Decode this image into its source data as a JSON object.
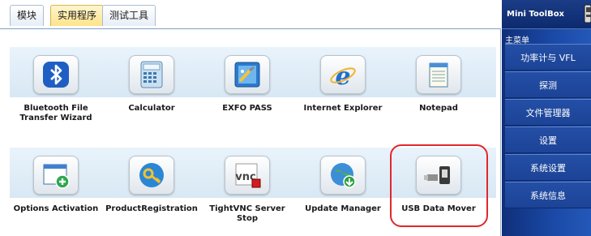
{
  "tabs": [
    {
      "label": "模块",
      "active": false
    },
    {
      "label": "实用程序",
      "active": true
    },
    {
      "label": "测试工具",
      "active": false
    }
  ],
  "apps_row1": [
    {
      "label": "Bluetooth File Transfer Wizard",
      "icon": "bluetooth-icon"
    },
    {
      "label": "Calculator",
      "icon": "calculator-icon"
    },
    {
      "label": "EXFO PASS",
      "icon": "exfo-pass-icon"
    },
    {
      "label": "Internet Explorer",
      "icon": "internet-explorer-icon"
    },
    {
      "label": "Notepad",
      "icon": "notepad-icon"
    }
  ],
  "apps_row2": [
    {
      "label": "Options Activation",
      "icon": "options-activation-icon"
    },
    {
      "label": "ProductRegistration",
      "icon": "product-registration-icon"
    },
    {
      "label": "TightVNC Server Stop",
      "icon": "tightvnc-icon"
    },
    {
      "label": "Update Manager",
      "icon": "update-manager-icon"
    },
    {
      "label": "USB Data Mover",
      "icon": "usb-data-mover-icon",
      "highlighted": true
    }
  ],
  "sidebar": {
    "title": "Mini ToolBox",
    "menu_caption": "主菜单",
    "items": [
      {
        "label": "功率计与 VFL"
      },
      {
        "label": "探测"
      },
      {
        "label": "文件管理器"
      },
      {
        "label": "设置"
      },
      {
        "label": "系统设置"
      },
      {
        "label": "系统信息"
      }
    ]
  },
  "colors": {
    "highlight": "#e0282e",
    "active_tab": "#ffe38a",
    "sidebar_bg": "#1b4aa8"
  }
}
